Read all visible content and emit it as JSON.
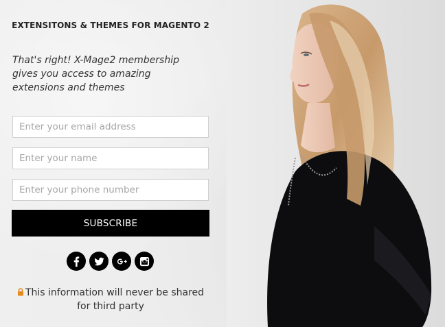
{
  "popup": {
    "heading": "EXTENSITONS & THEMES FOR MAGENTO 2",
    "intro": "That's right! X-Mage2 membership gives you access to amazing extensions and themes",
    "form": {
      "email_placeholder": "Enter your email address",
      "name_placeholder": "Enter your name",
      "phone_placeholder": "Enter your phone number",
      "subscribe_label": "SUBSCRIBE"
    },
    "social": [
      {
        "icon": "facebook-icon"
      },
      {
        "icon": "twitter-icon"
      },
      {
        "icon": "google-plus-icon"
      },
      {
        "icon": "instagram-icon"
      }
    ],
    "privacy_text": "This information will never be shared for third party",
    "colors": {
      "button_bg": "#000000",
      "lock_icon": "#e58a1f",
      "background": "#ececec"
    }
  }
}
